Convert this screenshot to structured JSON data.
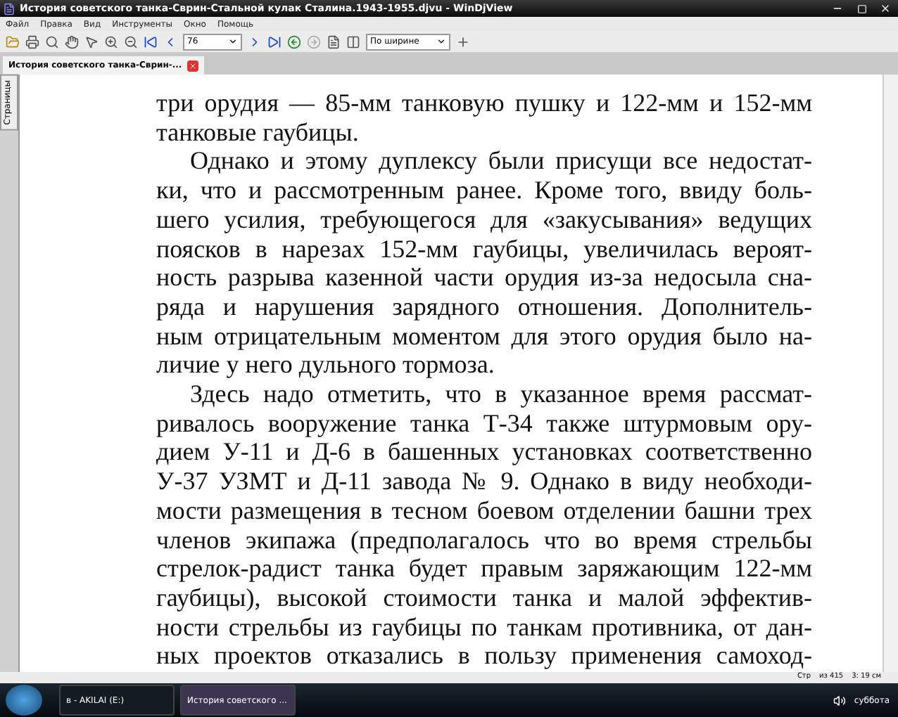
{
  "window": {
    "title": "История советского танка-Сврин-Стальной кулак Сталина.1943-1955.djvu - WinDjView"
  },
  "menu": [
    "Файл",
    "Правка",
    "Вид",
    "Инструменты",
    "Окно",
    "Помощь"
  ],
  "toolbar": {
    "page": "76",
    "zoom": "По ширине"
  },
  "tabs": [
    {
      "label": "История советского танка-Сврин-...",
      "selected": true
    }
  ],
  "sidebar": {
    "tab": "Страницы"
  },
  "paragraphs": [
    {
      "indented": false,
      "ends": true,
      "lines": [
        "три орудия — 85-мм танковую пушку и 122-мм и 152-мм",
        "танковые гаубицы."
      ]
    },
    {
      "indented": true,
      "ends": true,
      "lines": [
        "Однако и этому дуплексу были присущи все недостат-",
        "ки, что и рассмотренным ранее. Кроме того, ввиду боль-",
        "шего усилия, требующегося для «закусывания» ведущих",
        "поясков в нарезах 152-мм гаубицы, увеличилась вероят-",
        "ность разрыва казенной части орудия из-за недосыла сна-",
        "ряда и нарушения зарядного отношения. Дополнитель-",
        "ным отрицательным моментом для этого орудия было на-",
        "личие у него дульного тормоза."
      ]
    },
    {
      "indented": true,
      "ends": false,
      "lines": [
        "Здесь надо отметить, что в указанное время рассмат-",
        "ривалось вооружение танка Т-34 также штурмовым ору-",
        "дием У-11 и Д-6 в башенных установках соответственно",
        "У-37 УЗМТ и Д-11 завода № 9. Однако в виду необходи-",
        "мости размещения в тесном боевом отделении башни трех",
        "членов экипажа (предполагалось что во время стрельбы",
        "стрелок-радист танка будет правым заряжающим 122-мм",
        "гаубицы), высокой стоимости танка и малой эффектив-",
        "ности стрельбы из гаубицы по танкам противника, от дан-",
        "ных проектов отказались в пользу применения самоход-"
      ]
    }
  ],
  "status_bar": {
    "page_info": "Стр",
    "page_count": "из 415",
    "size": "3: 19 см"
  },
  "taskbar": {
    "items": [
      {
        "label": "в - AKILAI (E:)",
        "selected": false
      },
      {
        "label": "История советского ...",
        "selected": true
      }
    ],
    "day": "суббота"
  }
}
